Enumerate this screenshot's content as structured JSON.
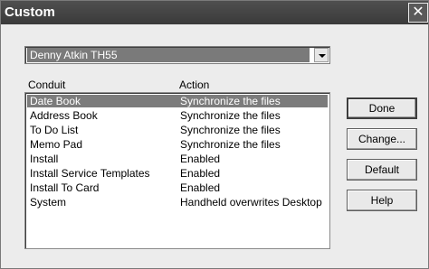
{
  "window": {
    "title": "Custom"
  },
  "device_select": {
    "value": "Denny Atkin TH55"
  },
  "columns": {
    "conduit": "Conduit",
    "action": "Action"
  },
  "conduits": [
    {
      "name": "Date Book",
      "action": "Synchronize the files",
      "selected": true
    },
    {
      "name": "Address Book",
      "action": "Synchronize the files",
      "selected": false
    },
    {
      "name": "To Do List",
      "action": "Synchronize the files",
      "selected": false
    },
    {
      "name": "Memo Pad",
      "action": "Synchronize the files",
      "selected": false
    },
    {
      "name": "Install",
      "action": "Enabled",
      "selected": false
    },
    {
      "name": "Install Service Templates",
      "action": "Enabled",
      "selected": false
    },
    {
      "name": "Install To Card",
      "action": "Enabled",
      "selected": false
    },
    {
      "name": "System",
      "action": "Handheld overwrites Desktop",
      "selected": false
    }
  ],
  "buttons": {
    "done": "Done",
    "change": "Change...",
    "default": "Default",
    "help": "Help"
  },
  "icons": {
    "close": "close-icon",
    "dropdown": "chevron-down-icon"
  }
}
